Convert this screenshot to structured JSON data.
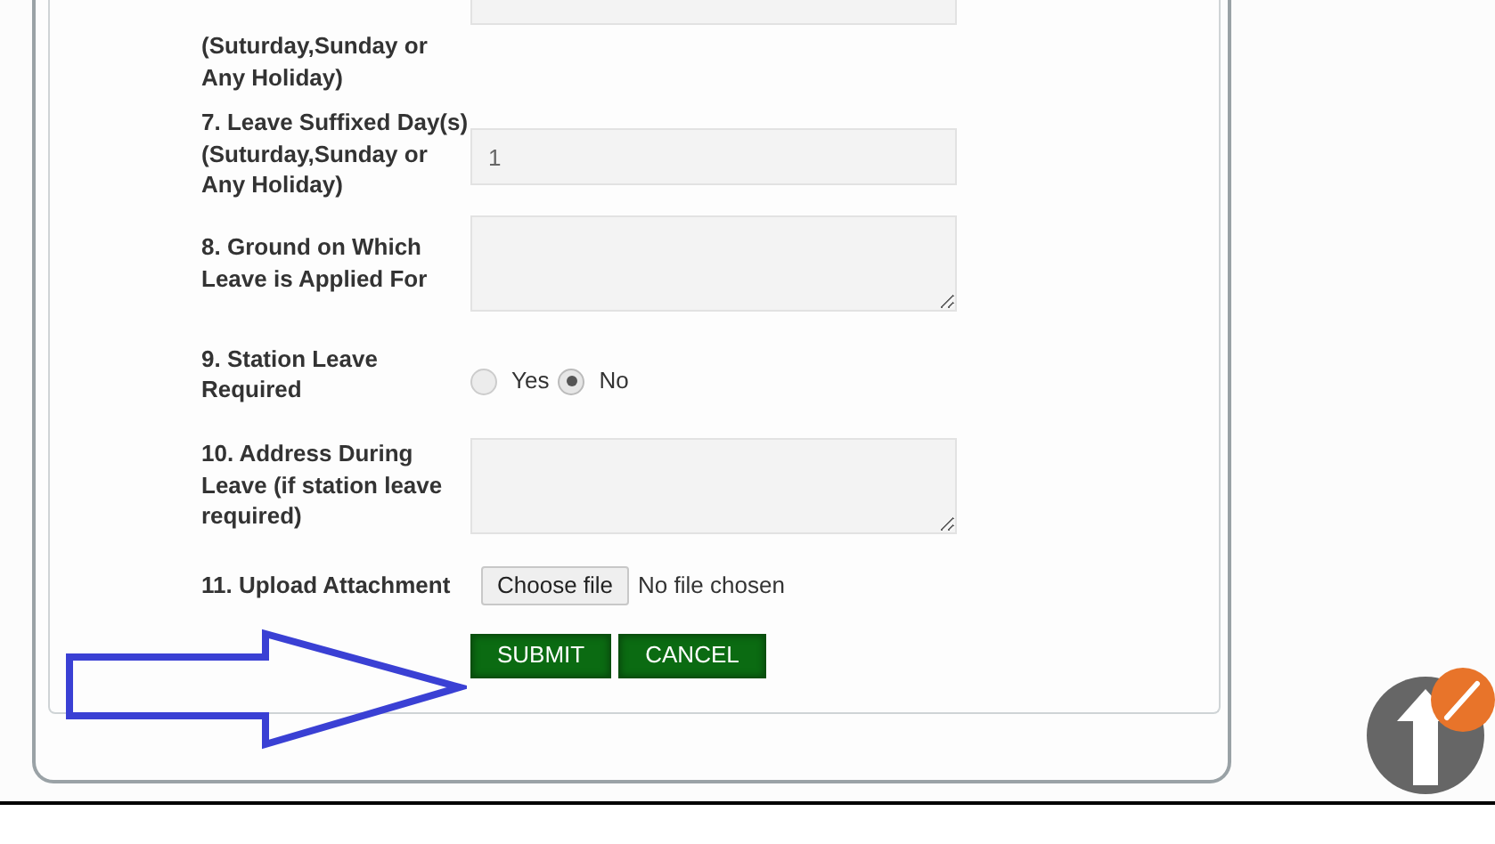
{
  "rows": [
    {
      "kind": "input",
      "label": "(Suturday,Sunday or Any Holiday)"
    },
    {
      "kind": "input",
      "label": "7. Leave Suffixed Day(s) (Suturday,Sunday or Any Holiday)",
      "value": "1"
    },
    {
      "kind": "textarea",
      "label": "8. Ground on Which Leave is Applied For"
    },
    {
      "kind": "radio",
      "label": "9. Station Leave Required",
      "options": [
        {
          "label": "Yes",
          "selected": false
        },
        {
          "label": "No",
          "selected": true
        }
      ]
    },
    {
      "kind": "textarea",
      "label": "10. Address During Leave (if station leave required)"
    },
    {
      "kind": "file",
      "label": "11. Upload Attachment",
      "button": "Choose file",
      "status": "No file chosen"
    }
  ],
  "buttons": [
    "SUBMIT",
    "CANCEL"
  ]
}
